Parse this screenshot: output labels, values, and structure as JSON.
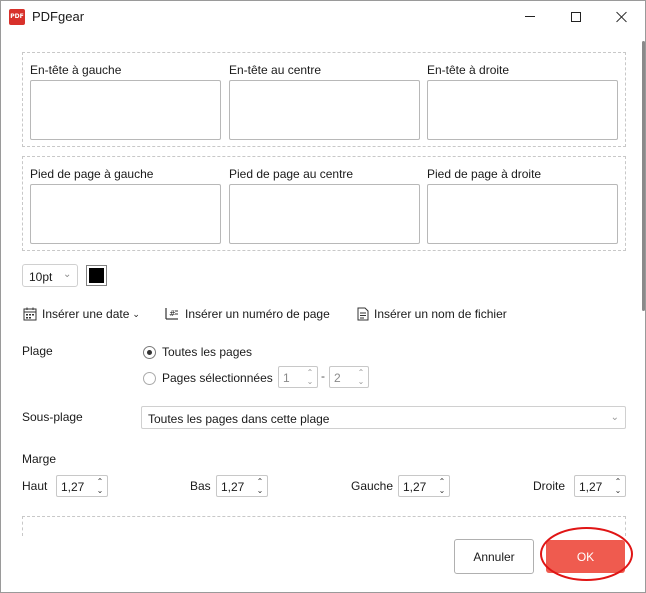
{
  "window": {
    "title": "PDFgear",
    "logo_text": "PDF",
    "accent_color": "#ef5b4f",
    "highlight_color": "#e01515"
  },
  "header_fields": [
    {
      "label": "En-tête à gauche",
      "value": ""
    },
    {
      "label": "En-tête au centre",
      "value": ""
    },
    {
      "label": "En-tête à droite",
      "value": ""
    }
  ],
  "footer_fields": [
    {
      "label": "Pied de page à gauche",
      "value": ""
    },
    {
      "label": "Pied de page au centre",
      "value": ""
    },
    {
      "label": "Pied de page à droite",
      "value": ""
    }
  ],
  "format": {
    "font_size": "10pt",
    "text_color": "#000000"
  },
  "tools": {
    "insert_date": "Insérer une date",
    "insert_page_number": "Insérer un numéro de page",
    "insert_filename": "Insérer un nom de fichier"
  },
  "range": {
    "label": "Plage",
    "all_pages": "Toutes les pages",
    "selected_pages": "Pages sélectionnées",
    "selected": "all",
    "from": "1",
    "separator": "-",
    "to": "2"
  },
  "subrange": {
    "label": "Sous-plage",
    "value": "Toutes les pages dans cette plage"
  },
  "margin": {
    "title": "Marge",
    "top_label": "Haut",
    "top_value": "1,27",
    "bottom_label": "Bas",
    "bottom_value": "1,27",
    "left_label": "Gauche",
    "left_value": "1,27",
    "right_label": "Droite",
    "right_value": "1,27"
  },
  "buttons": {
    "cancel": "Annuler",
    "ok": "OK"
  },
  "icons": {
    "minimize": "minimize-icon",
    "maximize": "maximize-icon",
    "close": "close-icon",
    "calendar": "calendar-icon",
    "page_number": "page-number-icon",
    "file": "file-icon"
  }
}
